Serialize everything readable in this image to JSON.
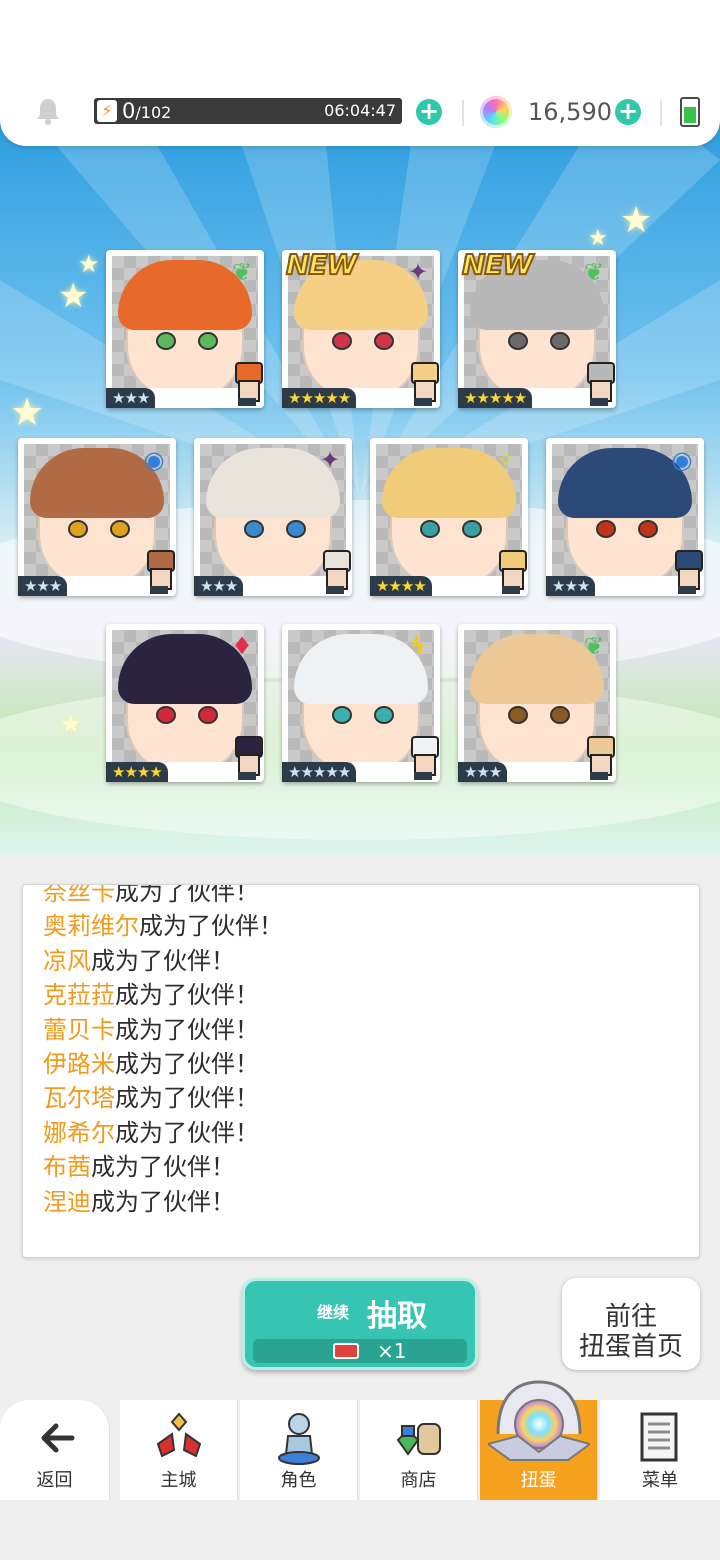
{
  "status_bar": {
    "stamina_current": "0",
    "stamina_max": "/102",
    "stamina_timer": "06:04:47",
    "gems": "16,590"
  },
  "cards": [
    {
      "row": 1,
      "stars": "★★★",
      "star_tier": "silver",
      "element": "leaf",
      "element_color": "#4cc25a",
      "is_new": false,
      "hair_color": "#e86a2a",
      "eye_color": "#5cb85c"
    },
    {
      "row": 1,
      "stars": "★★★★★",
      "star_tier": "gold",
      "element": "dark",
      "element_color": "#6a3a7a",
      "is_new": true,
      "new_label": "NEW",
      "hair_color": "#f5cf84",
      "eye_color": "#d0344a"
    },
    {
      "row": 1,
      "stars": "★★★★★",
      "star_tier": "gold",
      "element": "leaf",
      "element_color": "#4cc25a",
      "is_new": true,
      "new_label": "NEW",
      "hair_color": "#b8b8b8",
      "eye_color": "#6a6a6a"
    },
    {
      "row": 2,
      "stars": "★★★",
      "star_tier": "silver",
      "element": "water",
      "element_color": "#2f7fe0",
      "is_new": false,
      "hair_color": "#b06a44",
      "eye_color": "#e0a020"
    },
    {
      "row": 2,
      "stars": "★★★",
      "star_tier": "silver",
      "element": "dark",
      "element_color": "#6a3a7a",
      "is_new": false,
      "hair_color": "#e8e4dc",
      "eye_color": "#3a8ad0"
    },
    {
      "row": 2,
      "stars": "★★★★",
      "star_tier": "gold",
      "element": "light",
      "element_color": "#c9e04a",
      "is_new": false,
      "hair_color": "#f0cc78",
      "eye_color": "#3aa0a0"
    },
    {
      "row": 2,
      "stars": "★★★",
      "star_tier": "silver",
      "element": "water",
      "element_color": "#2f7fe0",
      "is_new": false,
      "hair_color": "#2c4a78",
      "eye_color": "#c0341a"
    },
    {
      "row": 3,
      "stars": "★★★★",
      "star_tier": "gold",
      "element": "fire",
      "element_color": "#e0304a",
      "is_new": false,
      "hair_color": "#2a2440",
      "eye_color": "#d02a3a"
    },
    {
      "row": 3,
      "stars": "★★★★★",
      "star_tier": "silver",
      "element": "thunder",
      "element_color": "#f5c71a",
      "is_new": false,
      "hair_color": "#eef2f4",
      "eye_color": "#3ab0b0"
    },
    {
      "row": 3,
      "stars": "★★★",
      "star_tier": "silver",
      "element": "leaf",
      "element_color": "#4cc25a",
      "is_new": false,
      "hair_color": "#ecc896",
      "eye_color": "#8a5a20"
    }
  ],
  "log": {
    "suffix": "成为了伙伴！",
    "names": [
      "奈丝卡",
      "奥莉维尔",
      "凉风",
      "克菈菈",
      "蕾贝卡",
      "伊路米",
      "瓦尔塔",
      "娜希尔",
      "布茜",
      "涅迪"
    ]
  },
  "draw_button": {
    "small_label": "继续",
    "main_label": "抽取",
    "cost": "×1"
  },
  "goto_button": {
    "line1": "前往",
    "line2": "扭蛋首页"
  },
  "nav": {
    "back": "返回",
    "main_city": "主城",
    "character": "角色",
    "shop": "商店",
    "gacha": "扭蛋",
    "menu": "菜单"
  },
  "colors": {
    "accent_teal": "#36c5b2",
    "nav_active": "#f7a21e",
    "name_highlight": "#f29a1c"
  }
}
